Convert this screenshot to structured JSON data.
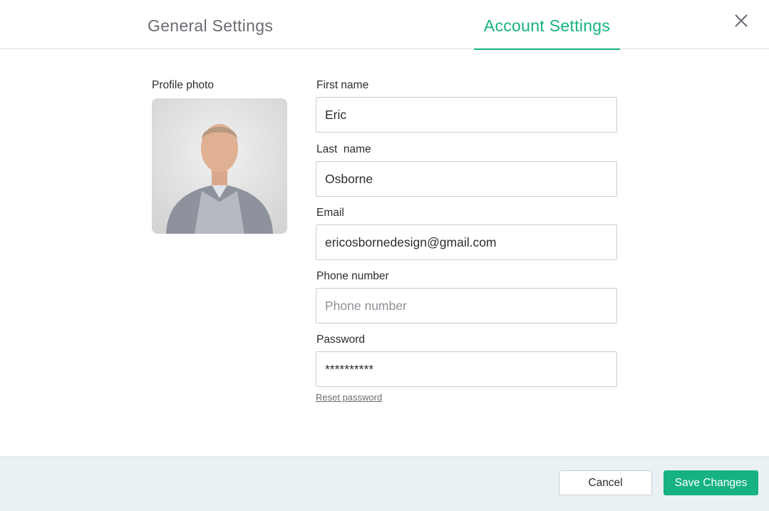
{
  "colors": {
    "accent": "#16b283"
  },
  "tabs": [
    {
      "label": "General Settings",
      "active": false
    },
    {
      "label": "Account Settings",
      "active": true
    }
  ],
  "profile": {
    "photo_label": "Profile photo"
  },
  "form": {
    "first_name": {
      "label": "First name",
      "value": "Eric"
    },
    "last_name": {
      "label": "Last  name",
      "value": "Osborne"
    },
    "email": {
      "label": "Email",
      "value": "ericosbornedesign@gmail.com"
    },
    "phone": {
      "label": "Phone number",
      "value": "",
      "placeholder": "Phone number"
    },
    "password": {
      "label": "Password",
      "value": "**********"
    },
    "reset_link": "Reset password"
  },
  "footer": {
    "cancel_label": "Cancel",
    "save_label": "Save Changes"
  },
  "icons": {
    "close": "close-icon"
  }
}
